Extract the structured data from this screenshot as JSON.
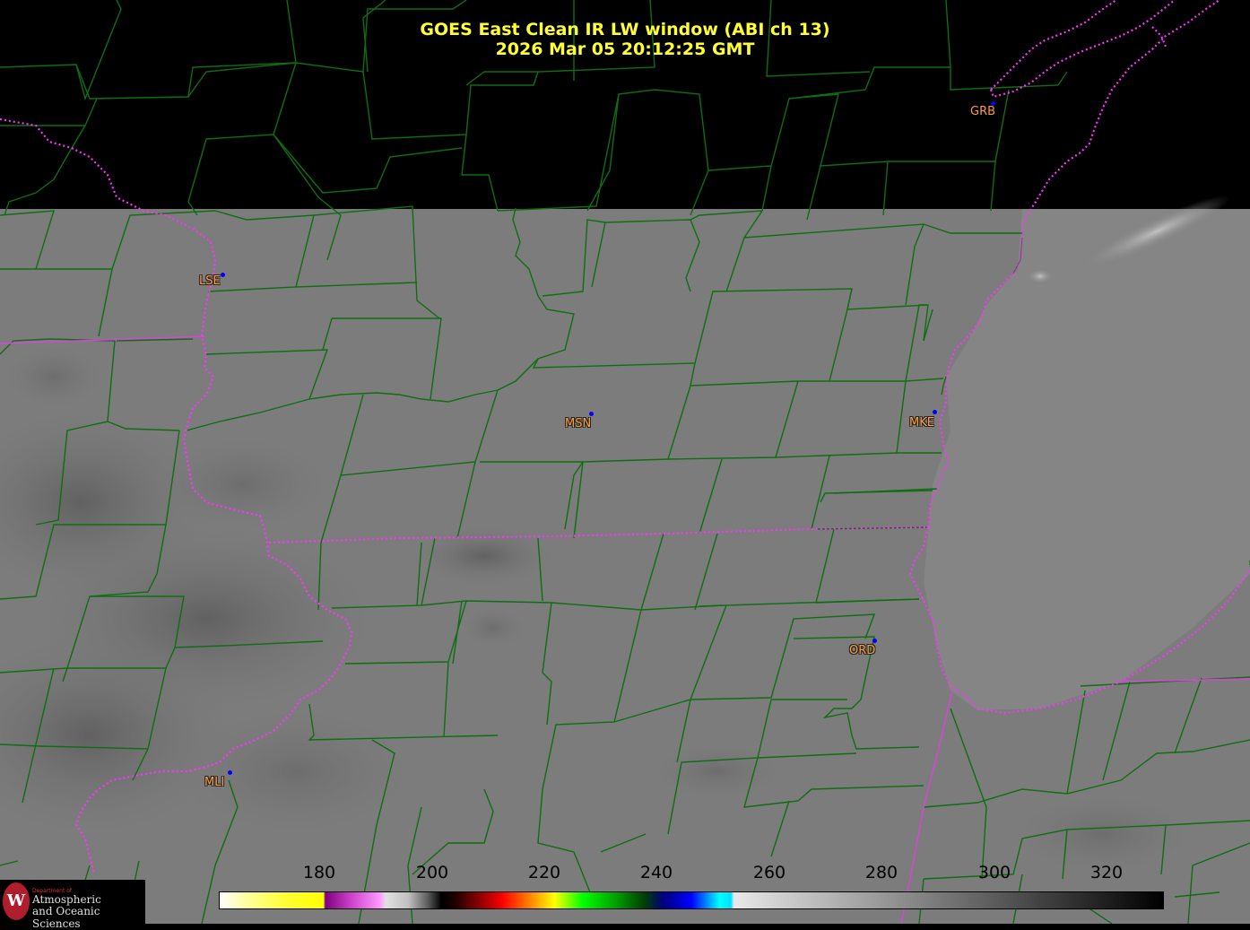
{
  "title": {
    "line1": "GOES East Clean IR LW window (ABI ch 13)",
    "line2": "2026 Mar 05  20:12:25 GMT"
  },
  "stations": [
    {
      "id": "lse",
      "label": "LSE"
    },
    {
      "id": "msn",
      "label": "MSN"
    },
    {
      "id": "mke",
      "label": "MKE"
    },
    {
      "id": "ord",
      "label": "ORD"
    },
    {
      "id": "mli",
      "label": "MLI"
    },
    {
      "id": "grb",
      "label": "GRB"
    }
  ],
  "colorbar": {
    "ticks": [
      "180",
      "200",
      "220",
      "240",
      "260",
      "280",
      "300",
      "320"
    ],
    "units_min": 165,
    "units_max": 333
  },
  "logo": {
    "dept": "Department of",
    "line1": "Atmospheric",
    "line2": "and Oceanic Sciences",
    "seal": "W"
  },
  "colors": {
    "county_lines": "#0f6e12",
    "state_lines": "#ff33ff",
    "title": "#ffff33",
    "station_label": "#ff9a3c",
    "station_dot": "#0000ff"
  }
}
